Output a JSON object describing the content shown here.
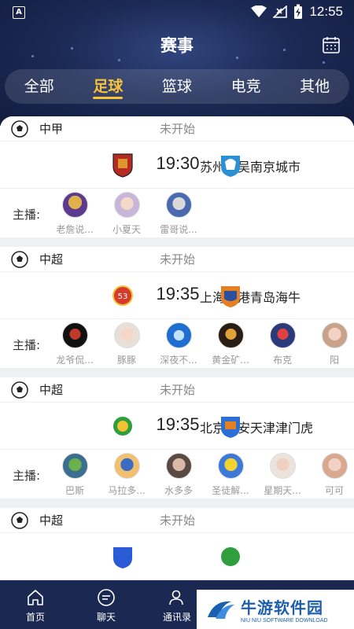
{
  "status_bar": {
    "carrier_badge": "A",
    "time": "12:55"
  },
  "page_title": "赛事",
  "tabs": [
    {
      "label": "全部",
      "active": false
    },
    {
      "label": "足球",
      "active": true
    },
    {
      "label": "篮球",
      "active": false
    },
    {
      "label": "电竞",
      "active": false
    },
    {
      "label": "其他",
      "active": false
    }
  ],
  "anchors_label": "主播:",
  "matches": [
    {
      "league": "中甲",
      "status": "未开始",
      "home": "苏州东吴",
      "time": "19:30",
      "away": "南京城市",
      "home_color": "#c0392b",
      "away_color": "#2b8fd6",
      "anchors": [
        "老詹说...",
        "小夏天",
        "雷哥说..."
      ]
    },
    {
      "league": "中超",
      "status": "未开始",
      "home": "上海海港",
      "time": "19:35",
      "away": "青岛海牛",
      "home_color": "#d63a2a",
      "away_color": "#e67e22",
      "anchors": [
        "龙爷侃...",
        "豚豚",
        "深夜不...",
        "黄金矿...",
        "布克",
        "阳"
      ]
    },
    {
      "league": "中超",
      "status": "未开始",
      "home": "北京国安",
      "time": "19:35",
      "away": "天津津门虎",
      "home_color": "#2e9e3e",
      "away_color": "#2a6fd6",
      "anchors": [
        "巴斯",
        "马拉多...",
        "水多多",
        "圣徒解...",
        "星期天...",
        "可可"
      ]
    },
    {
      "league": "中超",
      "status": "未开始",
      "home": "",
      "time": "",
      "away": "",
      "home_color": "#2a5bd6",
      "away_color": "#2e9e3e",
      "anchors": []
    }
  ],
  "bottom_nav": [
    {
      "label": "首页",
      "icon": "home-icon"
    },
    {
      "label": "聊天",
      "icon": "chat-icon"
    },
    {
      "label": "通讯录",
      "icon": "contacts-icon"
    },
    {
      "label": "",
      "icon": "trophy-icon"
    },
    {
      "label": "",
      "icon": "profile-icon"
    }
  ],
  "watermark": {
    "title": "牛游软件园",
    "subtitle": "NIU NIU SOFTWARE DOWNLOAD"
  },
  "colors": {
    "header": "#1c2a56",
    "accent": "#f5c43a",
    "nav": "#1b2851"
  }
}
